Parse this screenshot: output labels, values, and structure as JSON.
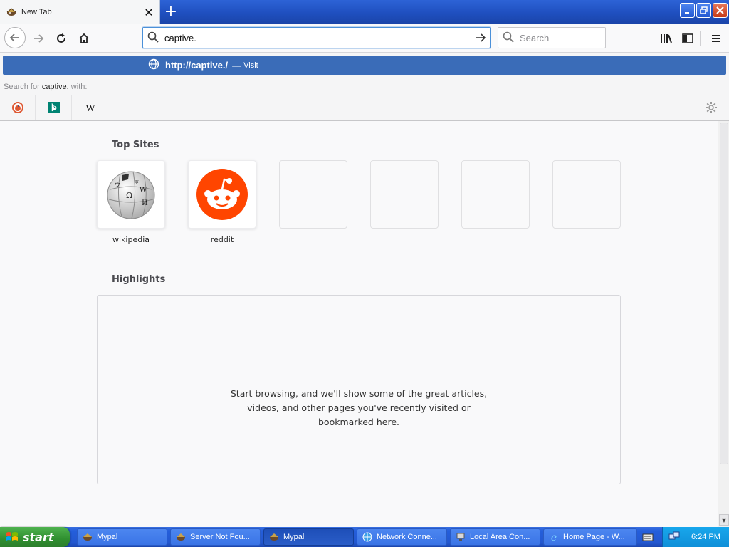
{
  "browser": {
    "tab": {
      "title": "New Tab",
      "favicon": "mypal-icon"
    },
    "new_tab_icon": "plus-icon",
    "window_controls": [
      "minimize-icon",
      "restore-icon",
      "close-icon"
    ],
    "urlbar": {
      "value": "captive."
    },
    "searchbar": {
      "placeholder": "Search"
    }
  },
  "popup": {
    "suggestion": {
      "url": "http://captive./",
      "dash": "—",
      "action": "Visit"
    },
    "search_for": {
      "prefix": "Search for",
      "term": "captive.",
      "suffix": "with:"
    },
    "engines": [
      "duckduckgo-icon",
      "bing-icon",
      "wikipedia-icon"
    ]
  },
  "newtab": {
    "top_sites_title": "Top Sites",
    "top_sites": [
      {
        "label": "wikipedia",
        "icon": "wikipedia-globe-icon"
      },
      {
        "label": "reddit",
        "icon": "reddit-icon"
      },
      {
        "label": ""
      },
      {
        "label": ""
      },
      {
        "label": ""
      },
      {
        "label": ""
      }
    ],
    "highlights_title": "Highlights",
    "highlights_message_lines": [
      "Start browsing, and we'll show some of the great articles,",
      "videos, and other pages you've recently visited or",
      "bookmarked here."
    ]
  },
  "taskbar": {
    "start_label": "start",
    "tasks": [
      {
        "label": "Mypal",
        "active": false
      },
      {
        "label": "Server Not Fou...",
        "active": false
      },
      {
        "label": "Mypal",
        "active": true
      },
      {
        "label": "Network Conne...",
        "active": false
      },
      {
        "label": "Local Area Con...",
        "active": false
      },
      {
        "label": "Home Page - W...",
        "active": false
      }
    ],
    "clock": "6:24 PM"
  },
  "colors": {
    "suggestion_bg": "#3a6cb8",
    "reddit": "#ff4500",
    "xp_blue": "#245edb",
    "xp_green": "#2f8f2f"
  }
}
